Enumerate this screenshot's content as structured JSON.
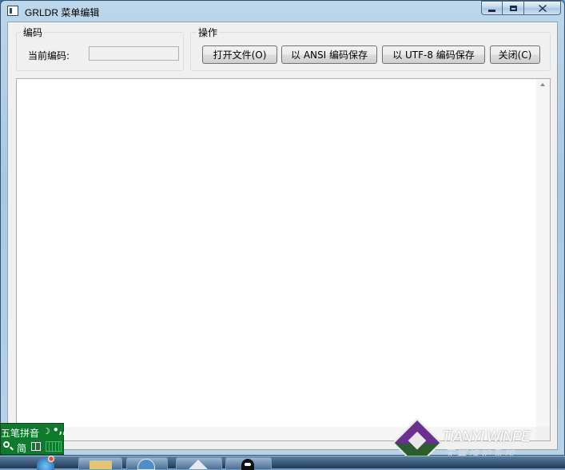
{
  "window": {
    "title": "GRLDR 菜单编辑",
    "caption": {
      "minimize": "minimize",
      "maximize": "maximize",
      "close": "close"
    }
  },
  "encoding_group": {
    "legend": "编码",
    "current_label": "当前编码:",
    "current_value": ""
  },
  "operations_group": {
    "legend": "操作",
    "buttons": {
      "open": "打开文件(O)",
      "save_ansi": "以 ANSI 编码保存",
      "save_utf8": "以 UTF-8 编码保存",
      "close": "关闭(C)"
    }
  },
  "editor": {
    "content": ""
  },
  "ime": {
    "name": "五笔拼音",
    "punct": "•,,",
    "mode": "简"
  },
  "watermark": {
    "brand": "TIANYI WINPE",
    "subtitle": "天翼维护系统"
  },
  "colors": {
    "client_bg": "#f0f0f0",
    "window_frame": "#a8c8e2",
    "ime_bg": "#0d7a2e",
    "taskbar": "#203a57"
  },
  "icons": [
    "app-icon",
    "minimize-icon",
    "maximize-icon",
    "close-icon",
    "search-icon",
    "moon-icon",
    "keyboard-icon",
    "start-orb-icon",
    "folder-icon",
    "browser-icon",
    "home-icon",
    "qq-icon",
    "watermark-logo-icon"
  ]
}
